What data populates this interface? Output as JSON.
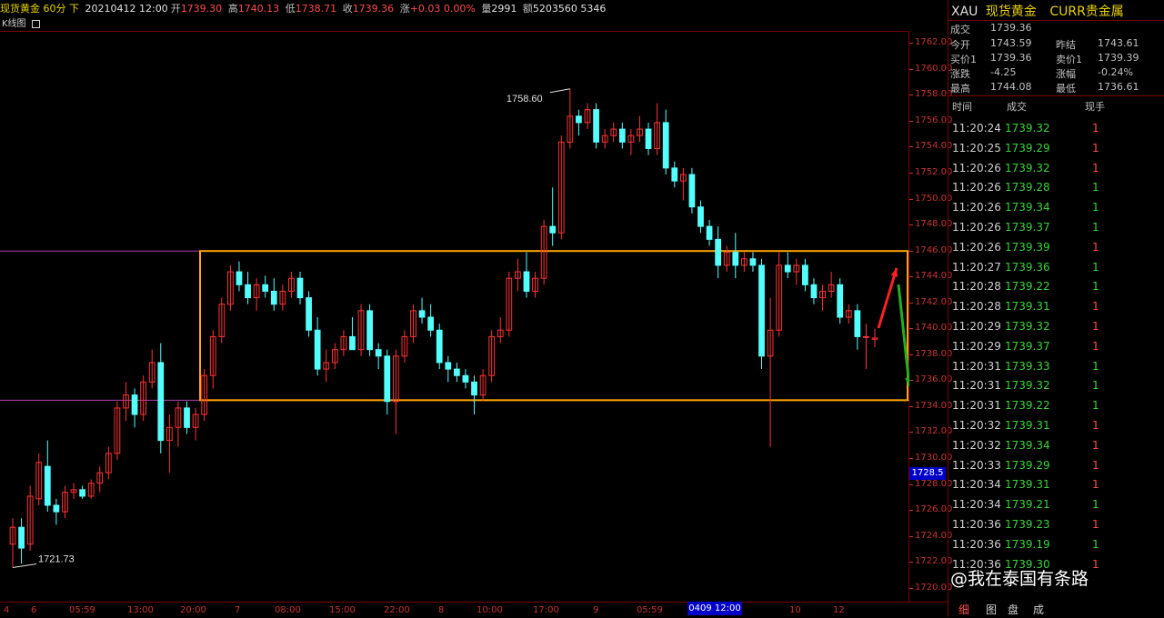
{
  "header": {
    "instrument": "现货黄金 60分 下",
    "datetime": "20210412 12:00",
    "open_label": "开",
    "open": "1739.30",
    "high_label": "高",
    "high": "1740.13",
    "low_label": "低",
    "low": "1738.71",
    "close_label": "收",
    "close": "1739.36",
    "change_label": "涨",
    "change": "+0.03 0.00%",
    "volume_label": "量",
    "volume": "2991",
    "amount_label": "额",
    "amount": "5203560 5346"
  },
  "chart_label": "K线图",
  "chart_label_icon": "square-icon",
  "chart_data": {
    "type": "candlestick",
    "ylim": [
      1719,
      1763
    ],
    "y_ticks": [
      "1762.00",
      "1760.00",
      "1758.00",
      "1756.00",
      "1754.00",
      "1752.00",
      "1750.00",
      "1748.00",
      "1746.00",
      "1744.00",
      "1742.00",
      "1740.00",
      "1738.00",
      "1736.00",
      "1734.00",
      "1732.00",
      "1730.00",
      "1728.00",
      "1726.00",
      "1724.00",
      "1722.00",
      "1720.00"
    ],
    "x_ticks": [
      "4",
      "6",
      "05:59",
      "13:00",
      "20:00",
      "7",
      "08:00",
      "15:00",
      "22:00",
      "8",
      "10:00",
      "17:00",
      "9",
      "05:59",
      "12:00",
      "10",
      "12"
    ],
    "max_label": "1758.60",
    "min_label": "1721.73",
    "cursor_price": "1728.5",
    "cursor_time": "0409 12:00",
    "up_color": "#ff3232",
    "down_color": "#54ffff",
    "box_color": "#ffa500",
    "candles": [
      [
        1723.5,
        1725.5,
        1721.7,
        1724.8
      ],
      [
        1724.8,
        1725.5,
        1722.0,
        1723.2
      ],
      [
        1723.5,
        1728.0,
        1723.0,
        1727.2
      ],
      [
        1727.0,
        1730.5,
        1726.5,
        1729.8
      ],
      [
        1729.5,
        1731.5,
        1726.0,
        1726.5
      ],
      [
        1726.5,
        1727.0,
        1725.0,
        1726.0
      ],
      [
        1726.0,
        1728.0,
        1725.5,
        1727.5
      ],
      [
        1727.5,
        1728.2,
        1727.0,
        1727.7
      ],
      [
        1727.7,
        1728.0,
        1727.0,
        1727.2
      ],
      [
        1727.2,
        1728.5,
        1727.0,
        1728.2
      ],
      [
        1728.2,
        1729.5,
        1727.5,
        1729.0
      ],
      [
        1729.0,
        1731.0,
        1728.5,
        1730.5
      ],
      [
        1730.5,
        1734.5,
        1730.0,
        1734.0
      ],
      [
        1734.0,
        1736.0,
        1733.0,
        1735.0
      ],
      [
        1735.0,
        1735.5,
        1732.5,
        1733.5
      ],
      [
        1733.5,
        1736.5,
        1733.0,
        1736.0
      ],
      [
        1736.0,
        1738.5,
        1735.5,
        1737.5
      ],
      [
        1737.5,
        1739.0,
        1730.5,
        1731.5
      ],
      [
        1731.5,
        1733.5,
        1729.0,
        1732.5
      ],
      [
        1732.5,
        1734.5,
        1731.0,
        1734.0
      ],
      [
        1734.0,
        1734.5,
        1732.0,
        1732.5
      ],
      [
        1732.5,
        1734.0,
        1731.5,
        1733.5
      ],
      [
        1733.5,
        1737.0,
        1733.0,
        1736.5
      ],
      [
        1736.5,
        1740.0,
        1735.5,
        1739.5
      ],
      [
        1739.5,
        1742.5,
        1739.0,
        1742.0
      ],
      [
        1742.0,
        1745.0,
        1741.5,
        1744.5
      ],
      [
        1744.5,
        1745.3,
        1743.0,
        1743.5
      ],
      [
        1743.5,
        1744.5,
        1742.0,
        1742.5
      ],
      [
        1742.5,
        1744.0,
        1741.5,
        1743.5
      ],
      [
        1743.5,
        1744.2,
        1742.5,
        1743.0
      ],
      [
        1743.0,
        1744.0,
        1741.5,
        1742.0
      ],
      [
        1742.0,
        1743.5,
        1741.5,
        1743.0
      ],
      [
        1743.0,
        1744.5,
        1742.5,
        1744.0
      ],
      [
        1744.0,
        1744.5,
        1742.0,
        1742.5
      ],
      [
        1742.5,
        1743.0,
        1739.5,
        1740.0
      ],
      [
        1740.0,
        1741.0,
        1736.5,
        1737.0
      ],
      [
        1737.0,
        1738.5,
        1736.0,
        1737.5
      ],
      [
        1737.5,
        1739.0,
        1737.0,
        1738.5
      ],
      [
        1738.5,
        1740.0,
        1738.0,
        1739.5
      ],
      [
        1739.5,
        1741.0,
        1738.5,
        1738.5
      ],
      [
        1738.5,
        1742.0,
        1738.0,
        1741.5
      ],
      [
        1741.5,
        1742.0,
        1738.0,
        1738.5
      ],
      [
        1738.5,
        1739.0,
        1737.0,
        1738.0
      ],
      [
        1738.0,
        1738.5,
        1733.5,
        1734.5
      ],
      [
        1734.5,
        1738.5,
        1732.0,
        1738.0
      ],
      [
        1738.0,
        1740.0,
        1737.5,
        1739.5
      ],
      [
        1739.5,
        1742.0,
        1739.0,
        1741.5
      ],
      [
        1741.5,
        1742.5,
        1740.5,
        1741.0
      ],
      [
        1741.0,
        1742.0,
        1739.5,
        1740.0
      ],
      [
        1740.0,
        1740.5,
        1737.0,
        1737.5
      ],
      [
        1737.5,
        1738.0,
        1736.0,
        1737.0
      ],
      [
        1737.0,
        1737.5,
        1736.0,
        1736.5
      ],
      [
        1736.5,
        1737.0,
        1735.5,
        1736.0
      ],
      [
        1736.0,
        1736.5,
        1733.5,
        1735.0
      ],
      [
        1735.0,
        1737.0,
        1734.5,
        1736.5
      ],
      [
        1736.5,
        1740.0,
        1736.0,
        1739.5
      ],
      [
        1739.5,
        1741.0,
        1739.0,
        1740.0
      ],
      [
        1740.0,
        1744.5,
        1739.5,
        1744.0
      ],
      [
        1744.0,
        1745.5,
        1743.0,
        1744.5
      ],
      [
        1744.5,
        1746.0,
        1742.5,
        1743.0
      ],
      [
        1743.0,
        1744.5,
        1742.5,
        1744.0
      ],
      [
        1744.0,
        1748.5,
        1743.5,
        1748.0
      ],
      [
        1748.0,
        1751.0,
        1746.5,
        1747.5
      ],
      [
        1747.5,
        1755.0,
        1747.0,
        1754.5
      ],
      [
        1754.5,
        1758.6,
        1754.0,
        1756.5
      ],
      [
        1756.5,
        1757.0,
        1755.0,
        1756.0
      ],
      [
        1756.0,
        1757.5,
        1755.5,
        1757.0
      ],
      [
        1757.0,
        1757.5,
        1754.0,
        1754.5
      ],
      [
        1754.5,
        1755.5,
        1754.0,
        1755.0
      ],
      [
        1755.0,
        1756.0,
        1754.5,
        1755.5
      ],
      [
        1755.5,
        1756.0,
        1754.0,
        1754.5
      ],
      [
        1754.5,
        1755.5,
        1753.5,
        1755.0
      ],
      [
        1755.0,
        1756.5,
        1754.5,
        1755.5
      ],
      [
        1755.5,
        1756.0,
        1753.5,
        1754.0
      ],
      [
        1754.0,
        1757.5,
        1753.5,
        1756.0
      ],
      [
        1756.0,
        1757.0,
        1752.0,
        1752.5
      ],
      [
        1752.5,
        1753.0,
        1751.0,
        1751.5
      ],
      [
        1751.5,
        1752.5,
        1750.0,
        1752.0
      ],
      [
        1752.0,
        1752.5,
        1749.0,
        1749.5
      ],
      [
        1749.5,
        1750.0,
        1747.5,
        1748.0
      ],
      [
        1748.0,
        1748.5,
        1746.5,
        1747.0
      ],
      [
        1747.0,
        1748.0,
        1744.0,
        1745.0
      ],
      [
        1745.0,
        1746.5,
        1744.5,
        1746.0
      ],
      [
        1746.0,
        1747.5,
        1744.0,
        1745.0
      ],
      [
        1745.0,
        1746.0,
        1744.5,
        1745.5
      ],
      [
        1745.5,
        1746.0,
        1744.5,
        1745.0
      ],
      [
        1745.0,
        1745.5,
        1737.0,
        1738.0
      ],
      [
        1738.0,
        1742.5,
        1731.0,
        1740.0
      ],
      [
        1740.0,
        1746.0,
        1739.5,
        1745.0
      ],
      [
        1745.0,
        1746.0,
        1744.0,
        1744.5
      ],
      [
        1744.5,
        1745.5,
        1743.5,
        1745.0
      ],
      [
        1745.0,
        1745.5,
        1743.0,
        1743.5
      ],
      [
        1743.5,
        1744.0,
        1742.0,
        1742.5
      ],
      [
        1742.5,
        1743.5,
        1741.5,
        1743.0
      ],
      [
        1743.0,
        1744.5,
        1742.5,
        1743.5
      ],
      [
        1743.5,
        1744.0,
        1740.5,
        1741.0
      ],
      [
        1741.0,
        1742.0,
        1740.5,
        1741.5
      ],
      [
        1741.5,
        1742.0,
        1738.5,
        1739.5
      ],
      [
        1739.5,
        1740.5,
        1737.0,
        1739.5
      ],
      [
        1739.3,
        1740.1,
        1738.7,
        1739.4
      ]
    ],
    "right_hlines": [
      1746.1,
      1734.6
    ]
  },
  "quote_panel": {
    "symbol": "XAU",
    "name": "现货黄金",
    "category": "CURR贵金属",
    "last_label": "成交",
    "last": "1739.36",
    "open_label": "今开",
    "open": "1743.59",
    "prev_label": "昨结",
    "prev": "1743.61",
    "bid_label": "买价1",
    "bid": "1739.36",
    "ask_label": "卖价1",
    "ask": "1739.39",
    "chg_label": "涨跌",
    "chg": "-4.25",
    "pct_label": "涨幅",
    "pct": "-0.24%",
    "high_label": "最高",
    "high": "1744.08",
    "low_label": "最低",
    "low": "1736.61"
  },
  "tick_table": {
    "headers": [
      "时间",
      "成交",
      "现手"
    ],
    "rows": [
      [
        "11:20:24",
        "1739.32",
        "1"
      ],
      [
        "11:20:25",
        "1739.29",
        "1"
      ],
      [
        "11:20:26",
        "1739.32",
        "1"
      ],
      [
        "11:20:26",
        "1739.28",
        "1"
      ],
      [
        "11:20:26",
        "1739.34",
        "1"
      ],
      [
        "11:20:26",
        "1739.37",
        "1"
      ],
      [
        "11:20:26",
        "1739.39",
        "1"
      ],
      [
        "11:20:27",
        "1739.36",
        "1"
      ],
      [
        "11:20:28",
        "1739.22",
        "1"
      ],
      [
        "11:20:28",
        "1739.31",
        "1"
      ],
      [
        "11:20:29",
        "1739.32",
        "1"
      ],
      [
        "11:20:29",
        "1739.37",
        "1"
      ],
      [
        "11:20:31",
        "1739.33",
        "1"
      ],
      [
        "11:20:31",
        "1739.32",
        "1"
      ],
      [
        "11:20:31",
        "1739.22",
        "1"
      ],
      [
        "11:20:32",
        "1739.31",
        "1"
      ],
      [
        "11:20:32",
        "1739.34",
        "1"
      ],
      [
        "11:20:33",
        "1739.29",
        "1"
      ],
      [
        "11:20:34",
        "1739.31",
        "1"
      ],
      [
        "11:20:34",
        "1739.21",
        "1"
      ],
      [
        "11:20:36",
        "1739.23",
        "1"
      ],
      [
        "11:20:36",
        "1739.19",
        "1"
      ],
      [
        "11:20:36",
        "1739.30",
        "1"
      ]
    ],
    "vol_colors": [
      "#ff4b4b",
      "#ff4b4b",
      "#ff4b4b",
      "#39d339",
      "#39d339",
      "#39d339",
      "#ff4b4b",
      "#39d339",
      "#39d339",
      "#ff4b4b",
      "#ff4b4b",
      "#ff4b4b",
      "#39d339",
      "#39d339",
      "#39d339",
      "#ff4b4b",
      "#ff4b4b",
      "#ff4b4b",
      "#ff4b4b",
      "#39d339",
      "#ff4b4b",
      "#39d339",
      "#ff4b4b"
    ]
  },
  "bottom_tabs": [
    "细",
    "图",
    "盘",
    "成"
  ],
  "watermark": "@我在泰国有条路"
}
